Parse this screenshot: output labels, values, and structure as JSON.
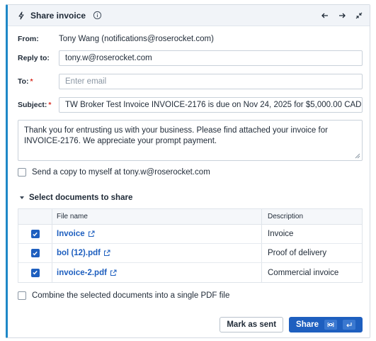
{
  "header": {
    "title": "Share invoice",
    "icons": [
      "bolt-icon",
      "info-icon",
      "arrow-left-icon",
      "arrow-right-icon",
      "collapse-icon"
    ]
  },
  "from": {
    "label": "From:",
    "value": "Tony Wang (notifications@roserocket.com)"
  },
  "reply_to": {
    "label": "Reply to:",
    "value": "tony.w@roserocket.com"
  },
  "to": {
    "label": "To:",
    "required": "*",
    "placeholder": "Enter email"
  },
  "subject": {
    "label": "Subject:",
    "required": "*",
    "value": "TW Broker Test Invoice INVOICE-2176 is due on Nov 24, 2025 for $5,000.00 CAD"
  },
  "message": "Thank you for entrusting us with your business. Please find attached your invoice for INVOICE-2176. We appreciate your prompt payment.",
  "send_copy": {
    "label": "Send a copy to myself at tony.w@roserocket.com",
    "checked": false
  },
  "documents": {
    "title": "Select documents to share",
    "columns": [
      "File name",
      "Description"
    ],
    "rows": [
      {
        "file": "Invoice",
        "description": "Invoice",
        "checked": true
      },
      {
        "file": "bol (12).pdf",
        "description": "Proof of delivery",
        "checked": true
      },
      {
        "file": "invoice-2.pdf",
        "description": "Commercial invoice",
        "checked": true
      }
    ]
  },
  "combine": {
    "label": "Combine the selected documents into a single PDF file",
    "checked": false
  },
  "buttons": {
    "mark_sent": "Mark as sent",
    "share": "Share"
  },
  "colors": {
    "accent": "#1e5fbf",
    "left_border": "#1e88c7",
    "required": "#d93025"
  }
}
